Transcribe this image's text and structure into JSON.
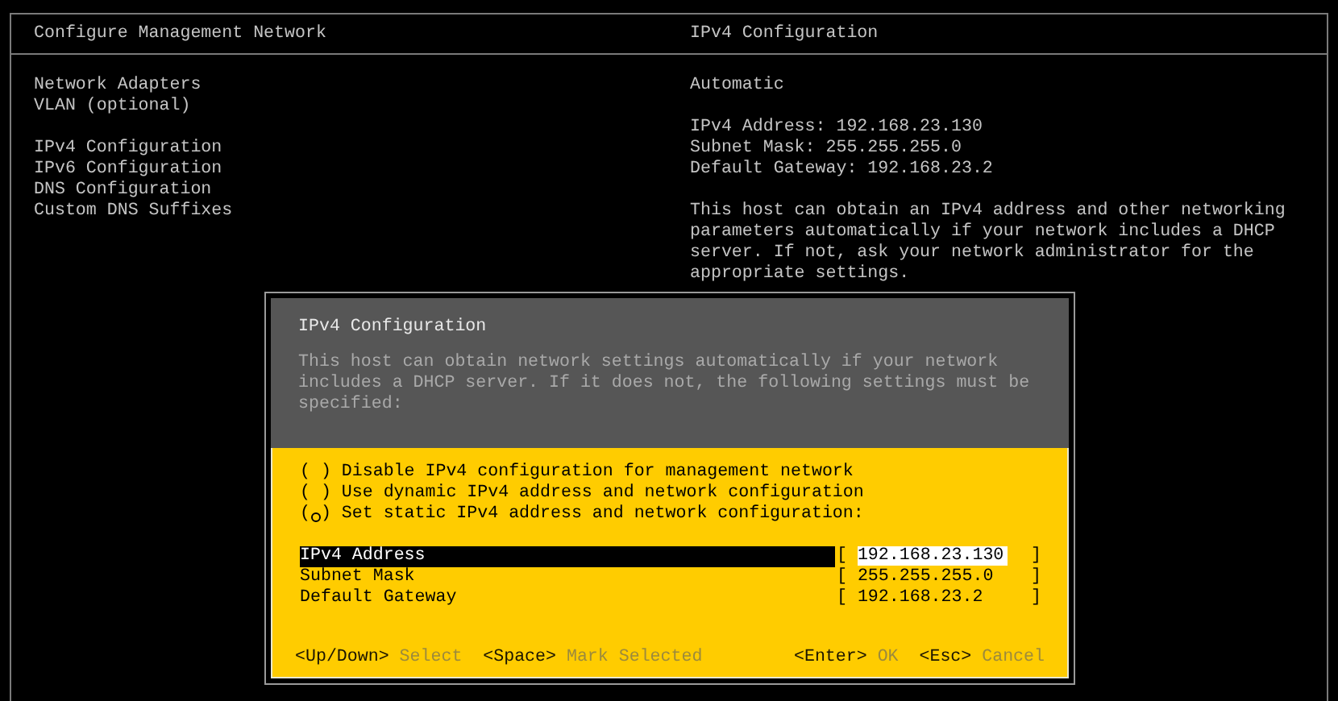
{
  "header": {
    "left_title": "Configure Management Network",
    "right_title": "IPv4 Configuration"
  },
  "menu": {
    "groups": [
      {
        "items": [
          "Network Adapters",
          "VLAN (optional)"
        ]
      },
      {
        "items": [
          "IPv4 Configuration",
          "IPv6 Configuration",
          "DNS Configuration",
          "Custom DNS Suffixes"
        ]
      }
    ]
  },
  "details": {
    "mode": "Automatic",
    "lines": [
      "IPv4 Address: 192.168.23.130",
      "Subnet Mask: 255.255.255.0",
      "Default Gateway: 192.168.23.2"
    ],
    "description": "This host can obtain an IPv4 address and other networking parameters automatically if your network includes a DHCP server. If not, ask your network administrator for the appropriate settings."
  },
  "dialog": {
    "title": "IPv4 Configuration",
    "description": "This host can obtain network settings automatically if your network includes a DHCP server. If it does not, the following settings must be specified:",
    "options": [
      {
        "open": "(",
        "close": ")",
        "label": "Disable IPv4 configuration for management network",
        "selected": false
      },
      {
        "open": "(",
        "close": ")",
        "label": "Use dynamic IPv4 address and network configuration",
        "selected": false
      },
      {
        "open": "(",
        "close": ")",
        "label": "Set static IPv4 address and network configuration:",
        "selected": true
      }
    ],
    "fields": [
      {
        "label": "IPv4 Address",
        "bracket_left": "[",
        "value": "192.168.23.130",
        "bracket_right": "]",
        "focused": true
      },
      {
        "label": "Subnet Mask",
        "bracket_left": "[",
        "value": "255.255.255.0",
        "bracket_right": "]",
        "focused": false
      },
      {
        "label": "Default Gateway",
        "bracket_left": "[",
        "value": "192.168.23.2",
        "bracket_right": "]",
        "focused": false
      }
    ],
    "hints_left": [
      {
        "key": "<Up/Down>",
        "action": "Select"
      },
      {
        "key": "<Space>",
        "action": "Mark Selected"
      }
    ],
    "hints_right": [
      {
        "key": "<Enter>",
        "action": "OK"
      },
      {
        "key": "<Esc>",
        "action": "Cancel"
      }
    ]
  }
}
